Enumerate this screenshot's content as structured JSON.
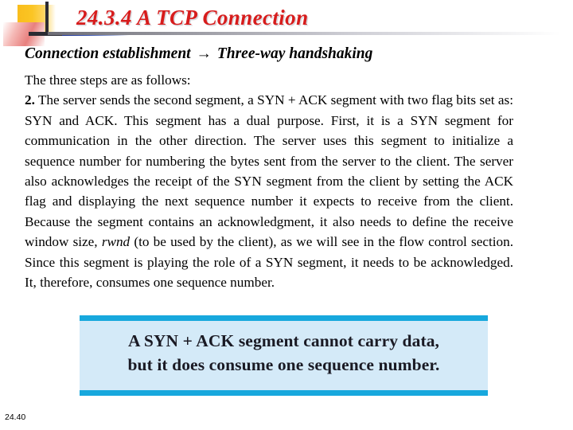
{
  "slide": {
    "title": "24.3.4  A TCP Connection",
    "title_color": "#d71c1c",
    "subtitle_before_arrow": "Connection establishment ",
    "subtitle_arrow": "→",
    "subtitle_after_arrow": " Three-way handshaking",
    "body": {
      "lead": "The three steps are as follows:",
      "item_number": "2.",
      "paragraph_part1": " The server sends the second segment, a SYN + ACK segment with two flag bits set as: SYN and ACK. This segment has a dual purpose. First, it is a SYN segment for communication in the other direction. The server uses this segment to initialize a sequence number for numbering the bytes sent from the server to the client. The server also acknowledges the receipt of the SYN segment from the client by setting the ACK flag and displaying the next sequence number it expects to receive from the client. Because the segment contains an acknowledgment, it also needs to define the receive window size, ",
      "paragraph_italic_term": "rwnd",
      "paragraph_part2": " (to be used by the client), as we will see in the flow control section. Since this segment is playing the role of a SYN segment, it needs to be acknowledged. It, therefore, consumes one sequence number."
    },
    "note": {
      "line1": "A SYN + ACK segment cannot carry data,",
      "line2": "but it does consume one sequence number.",
      "background_color": "#d4eaf8",
      "bar_color": "#17a8dd"
    },
    "footer_page": "24.40",
    "decoration": {
      "orange_color": "#f9bd1c",
      "pink_color": "#e8807e",
      "dark_color": "#2b2b33",
      "blue_color": "#1b2f8f"
    }
  }
}
